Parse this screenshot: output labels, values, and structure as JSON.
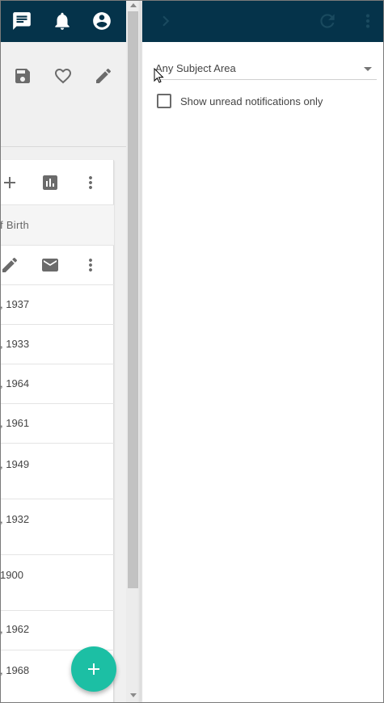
{
  "topbar": {
    "color": "#05334a",
    "icons": [
      "chat-icon",
      "bell-icon",
      "account-circle-icon"
    ]
  },
  "toolbar": {
    "icons": [
      "save-icon",
      "heart-outline-icon",
      "pencil-icon"
    ]
  },
  "card": {
    "header_icons": [
      "plus-icon",
      "bar-chart-icon",
      "more-vert-icon"
    ],
    "column_header": "f Birth",
    "action_icons": [
      "pencil-icon",
      "email-icon",
      "more-vert-icon"
    ],
    "rows": [
      ", 1937",
      ", 1933",
      ", 1964",
      ", 1961",
      ", 1949",
      ", 1932",
      "1900",
      ", 1962",
      ", 1968"
    ]
  },
  "fab": {
    "icon": "plus-icon",
    "color": "#1cbfa4"
  },
  "panel": {
    "header_icons": [
      "chevron-right-icon",
      "refresh-icon",
      "more-vert-icon"
    ],
    "subject_select": {
      "value": "Any Subject Area",
      "icon": "dropdown-arrow-icon"
    },
    "unread_checkbox": {
      "label": "Show unread notifications only",
      "checked": false
    }
  }
}
